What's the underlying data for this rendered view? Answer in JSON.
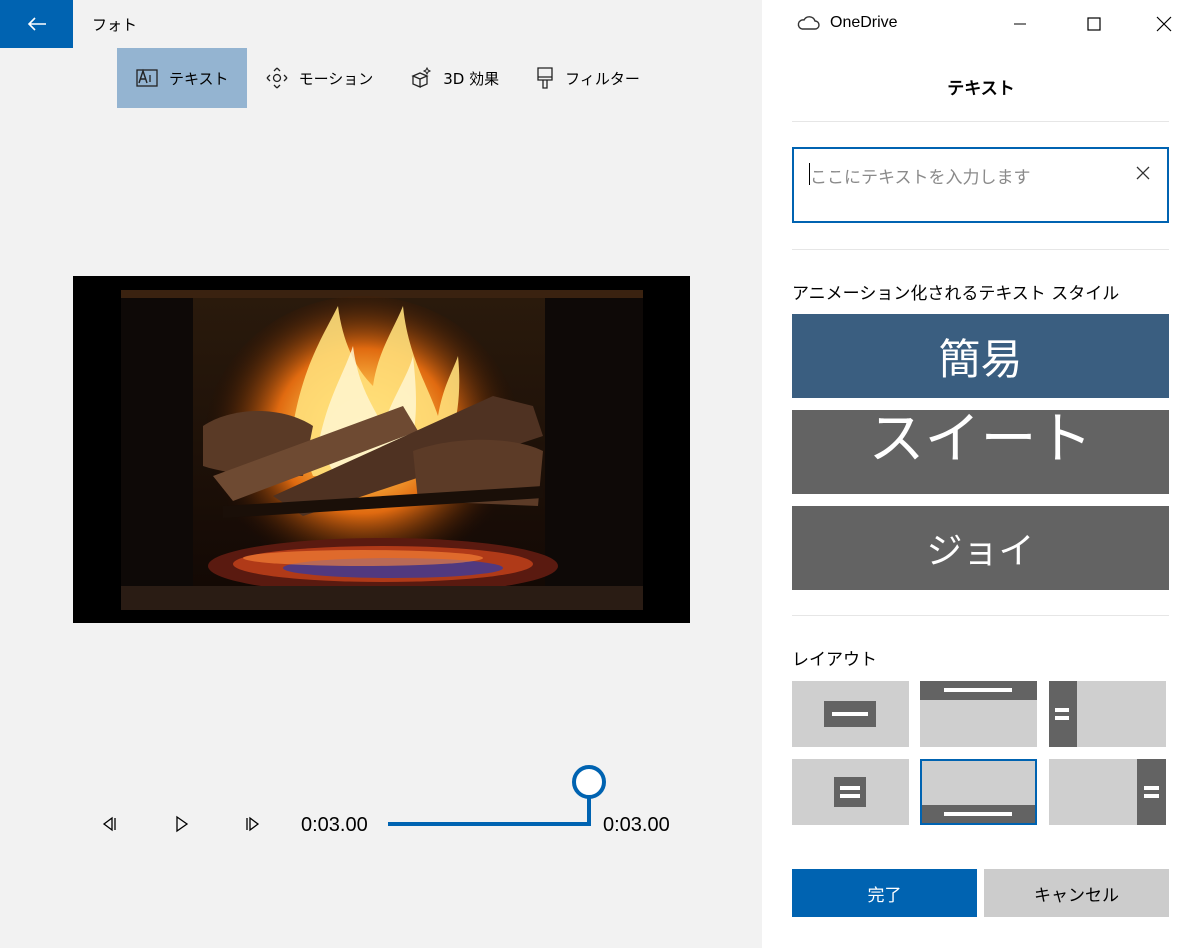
{
  "app": {
    "title": "フォト"
  },
  "window": {
    "onedrive_label": "OneDrive"
  },
  "toolbar": {
    "items": [
      {
        "label": "テキスト",
        "icon": "text-icon",
        "active": true
      },
      {
        "label": "モーション",
        "icon": "motion-icon",
        "active": false
      },
      {
        "label": "3D 効果",
        "icon": "3d-effects-icon",
        "active": false
      },
      {
        "label": "フィルター",
        "icon": "filter-icon",
        "active": false
      }
    ]
  },
  "playback": {
    "current_time": "0:03.00",
    "end_time": "0:03.00",
    "progress": 1.0
  },
  "panel": {
    "title": "テキスト",
    "input_placeholder": "ここにテキストを入力します",
    "styles_heading": "アニメーション化されるテキスト スタイル",
    "styles": [
      {
        "label": "簡易",
        "selected": true
      },
      {
        "label": "スイート",
        "selected": false
      },
      {
        "label": "ジョイ",
        "selected": false
      }
    ],
    "layout_heading": "レイアウト",
    "layouts": [
      {
        "id": "center",
        "selected": false
      },
      {
        "id": "top",
        "selected": false
      },
      {
        "id": "left-vertical",
        "selected": false
      },
      {
        "id": "center-stacked",
        "selected": false
      },
      {
        "id": "bottom",
        "selected": true
      },
      {
        "id": "right-vertical",
        "selected": false
      }
    ],
    "done_label": "完了",
    "cancel_label": "キャンセル"
  },
  "colors": {
    "accent": "#0063b1",
    "active_tool": "#94b4d1",
    "style_selected": "#3a5e80",
    "style_normal": "#636363"
  }
}
